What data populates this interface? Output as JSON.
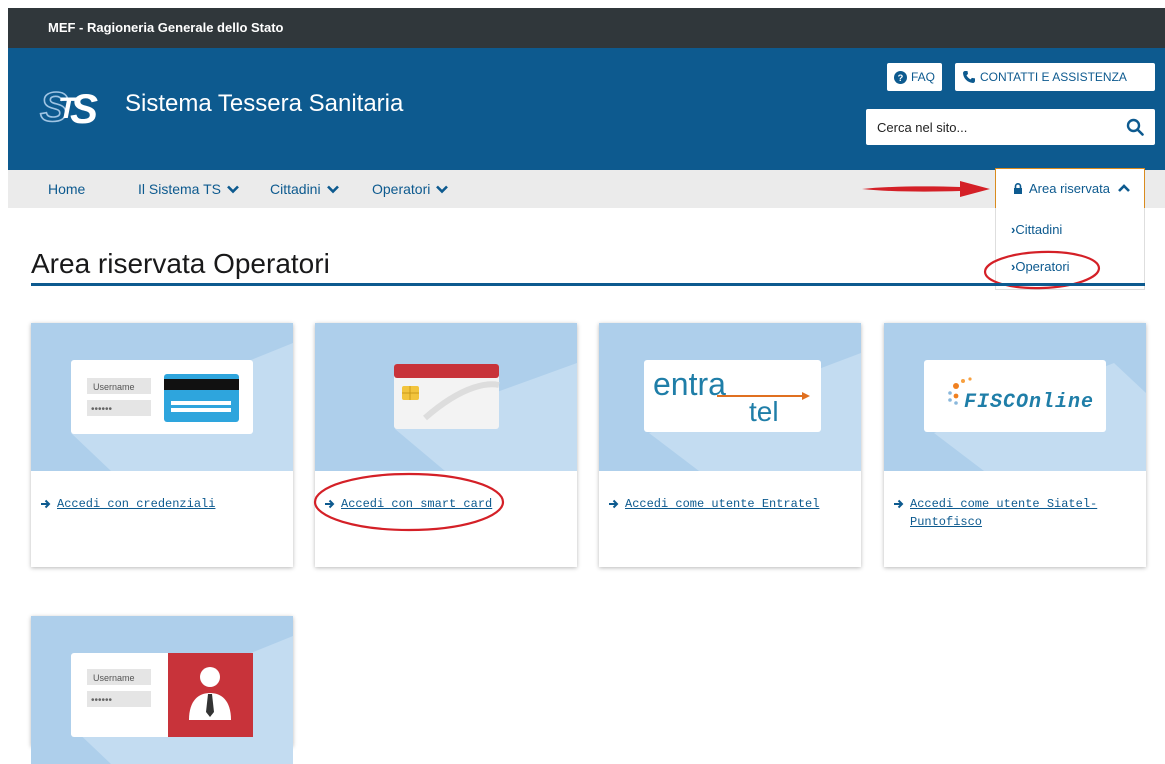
{
  "topbar": {
    "label": "MEF - Ragioneria Generale dello Stato"
  },
  "header": {
    "brand": "Sistema Tessera Sanitaria",
    "faq_label": "FAQ",
    "contact_label": "CONTATTI E ASSISTENZA",
    "search_placeholder": "Cerca nel sito..."
  },
  "nav": {
    "items": [
      {
        "label": "Home"
      },
      {
        "label": "Il Sistema TS"
      },
      {
        "label": "Cittadini"
      },
      {
        "label": "Operatori"
      }
    ],
    "reserved": {
      "label": "Area riservata",
      "dropdown": [
        {
          "label": "Cittadini"
        },
        {
          "label": "Operatori"
        }
      ]
    }
  },
  "main": {
    "title": "Area riservata Operatori",
    "cards": [
      {
        "link": "Accedi con credenziali",
        "image": {
          "field_label": "Username",
          "field_value": "••••••"
        }
      },
      {
        "link": "Accedi con smart card"
      },
      {
        "link": "Accedi come utente Entratel",
        "image": {
          "logo_text_1": "entra",
          "logo_text_2": "tel"
        }
      },
      {
        "link": "Accedi come utente Siatel-Puntofisco",
        "image": {
          "logo_text": "FISCOnline"
        }
      },
      {
        "image": {
          "field_label": "Username",
          "field_value": "••••••"
        }
      }
    ]
  },
  "colors": {
    "topbar": "#30373b",
    "header": "#0d5a8f",
    "nav": "#ebebeb",
    "accent_orange": "#d98b1e",
    "annotation_red": "#d42027"
  }
}
